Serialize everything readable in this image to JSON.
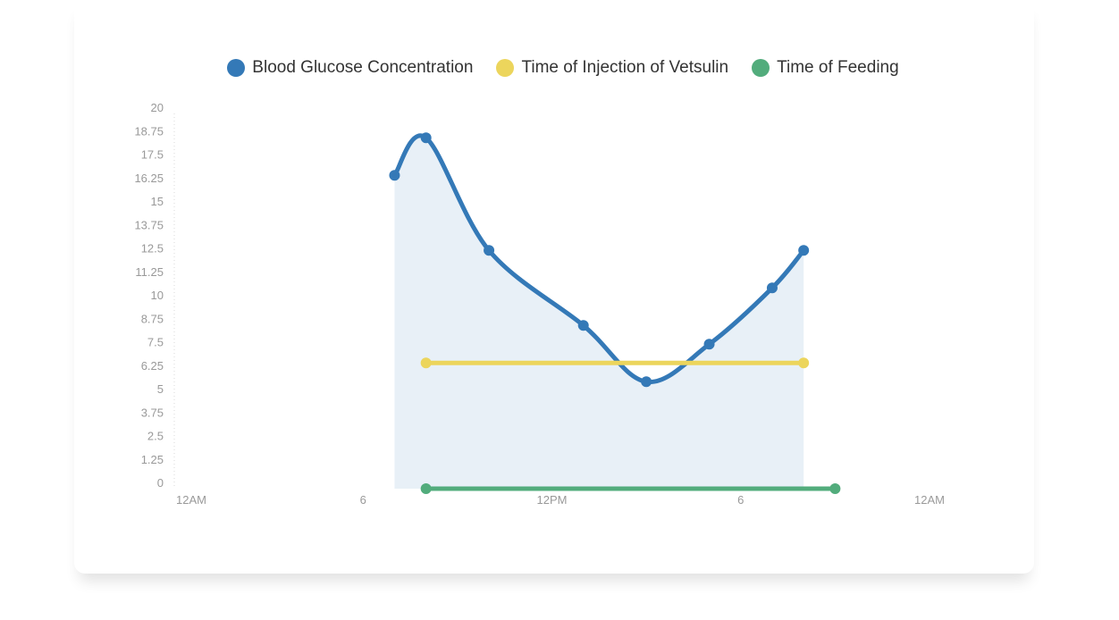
{
  "colors": {
    "glucose": "#3479b7",
    "glucose_fill": "#e8f0f7",
    "injection": "#ecd55c",
    "feeding": "#52ac7c",
    "axis_text": "#999999"
  },
  "legend": [
    {
      "label": "Blood Glucose Concentration",
      "color": "#3479b7"
    },
    {
      "label": "Time of Injection of Vetsulin",
      "color": "#ecd55c"
    },
    {
      "label": "Time of Feeding",
      "color": "#52ac7c"
    }
  ],
  "chart_data": {
    "type": "line",
    "title": "",
    "xlabel": "",
    "ylabel": "",
    "ylim": [
      0,
      20
    ],
    "xlim_hours": [
      0,
      24
    ],
    "y_ticks": [
      "0",
      "1.25",
      "2.5",
      "3.75",
      "5",
      "6.25",
      "7.5",
      "8.75",
      "10",
      "11.25",
      "12.5",
      "13.75",
      "15",
      "16.25",
      "17.5",
      "18.75",
      "20"
    ],
    "x_ticks": [
      {
        "hour": 0,
        "label": "12AM"
      },
      {
        "hour": 6,
        "label": "6"
      },
      {
        "hour": 12,
        "label": "12PM"
      },
      {
        "hour": 18,
        "label": "6"
      },
      {
        "hour": 24,
        "label": "12AM"
      }
    ],
    "grid": false,
    "legend_position": "top",
    "series": [
      {
        "name": "Blood Glucose Concentration",
        "color": "#3479b7",
        "smooth": true,
        "area": true,
        "x_hours": [
          7,
          8,
          10,
          13,
          15,
          17,
          19,
          20
        ],
        "values": [
          16.7,
          18.7,
          12.7,
          8.7,
          5.7,
          7.7,
          10.7,
          12.7
        ]
      },
      {
        "name": "Time of Injection of Vetsulin",
        "color": "#ecd55c",
        "smooth": false,
        "area": false,
        "x_hours": [
          8,
          20
        ],
        "values": [
          6.7,
          6.7
        ]
      },
      {
        "name": "Time of Feeding",
        "color": "#52ac7c",
        "smooth": false,
        "area": false,
        "x_hours": [
          8,
          21
        ],
        "values": [
          0,
          0
        ]
      }
    ]
  }
}
